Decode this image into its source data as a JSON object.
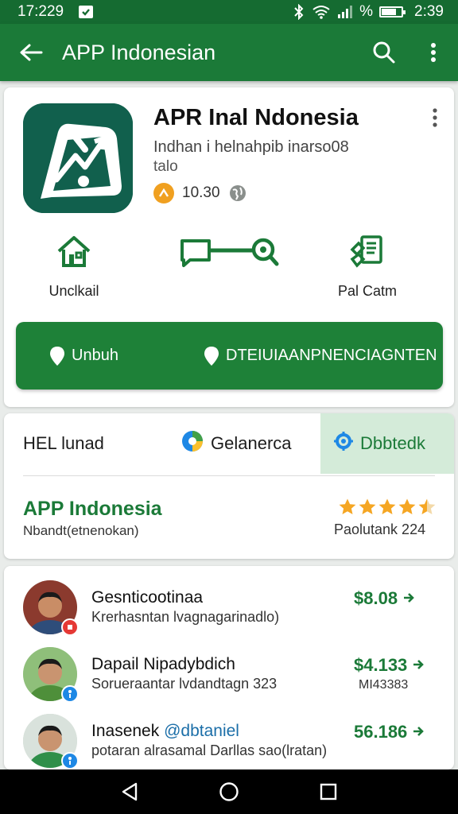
{
  "status_bar": {
    "time": "17:229",
    "icons": [
      "notification-icon",
      "bluetooth-icon",
      "wifi-icon",
      "signal-icon",
      "battery-icon"
    ],
    "battery_percent": 0.7,
    "battery_label": "%",
    "right_time": "2:39"
  },
  "app_bar": {
    "title": "APP Indonesian",
    "icons": [
      "back-arrow-icon",
      "search-icon",
      "more-vert-icon"
    ]
  },
  "app_header": {
    "name": "APR Inal Ndonesia",
    "subtitle": "Indhan i helnahpib inarso08",
    "subtitle2": "talo",
    "rating": "10.30"
  },
  "features": [
    {
      "label": "Unclkail",
      "icon": "house-icon"
    },
    {
      "label": "",
      "icon": "chat-search-icon"
    },
    {
      "label": "Pal Catm",
      "icon": "documents-icon"
    }
  ],
  "action_bar": {
    "left_label": "Unbuh",
    "right_label": "DTEIUIAANPNENCIAGNTEN"
  },
  "tabs": [
    {
      "label": "HEL lunad",
      "selected": false
    },
    {
      "label": "Gelanerca",
      "selected": false
    },
    {
      "label": "Dbbtedk",
      "selected": true
    }
  ],
  "summary": {
    "title": "APP Indonesia",
    "subtitle": "Nbandt(etnenokan)",
    "rank": "Paolutank 224",
    "stars": 4.5
  },
  "list": [
    {
      "name": "Gesnticootinaa",
      "handle": "",
      "desc": "Krerhasntan lvagnagarinadlo)",
      "price": "$8.08",
      "extra": "",
      "badge_color": "#e53935"
    },
    {
      "name": "Dapail Nipadybdich",
      "handle": "",
      "desc": "Sorueraantar lvdandtagn 323",
      "price": "$4.133",
      "extra": "MI43383",
      "badge_color": "#1e88e5"
    },
    {
      "name": "Inasenek ",
      "handle": "@dbtaniel",
      "desc": "potaran alrasamal Darllas sao(lratan)",
      "price": "56.186",
      "extra": "",
      "badge_color": "#1e88e5"
    }
  ],
  "colors": {
    "primary": "#1b7a38",
    "status": "#156b31",
    "accent_star": "#f5a623",
    "tab_selected_bg": "#d4ebd9"
  }
}
